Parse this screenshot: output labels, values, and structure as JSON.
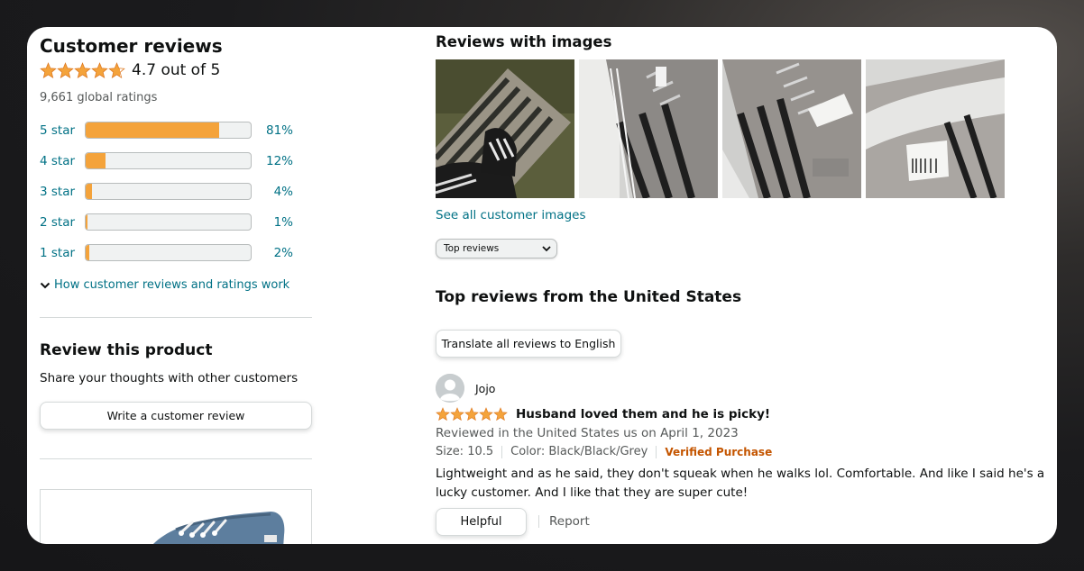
{
  "ratings": {
    "title": "Customer reviews",
    "stars": 4.7,
    "average_text": "4.7 out of 5",
    "global_ratings": "9,661 global ratings",
    "histogram": [
      {
        "label": "5 star",
        "percent_text": "81%",
        "fraction": 0.81
      },
      {
        "label": "4 star",
        "percent_text": "12%",
        "fraction": 0.12
      },
      {
        "label": "3 star",
        "percent_text": "4%",
        "fraction": 0.04
      },
      {
        "label": "2 star",
        "percent_text": "1%",
        "fraction": 0.01
      },
      {
        "label": "1 star",
        "percent_text": "2%",
        "fraction": 0.02
      }
    ],
    "how_link": "How customer reviews and ratings work"
  },
  "review_product": {
    "title": "Review this product",
    "subtitle": "Share your thoughts with other customers",
    "button_label": "Write a customer review"
  },
  "images_section": {
    "title": "Reviews with images",
    "see_all": "See all customer images",
    "thumbnail_count": 4
  },
  "sort": {
    "selected": "Top reviews"
  },
  "top_reviews": {
    "title": "Top reviews from the United States",
    "translate_button": "Translate all reviews to English"
  },
  "review": {
    "reviewer": "Jojo",
    "stars": 5,
    "headline": "Husband loved them and he is picky!",
    "date_line": "Reviewed in the United States us on April 1, 2023",
    "size": "Size: 10.5",
    "color": "Color: Black/Black/Grey",
    "verified": "Verified Purchase",
    "body": "Lightweight and as he said, they don't squeak when he walks lol. Comfortable. And like I said he's a lucky customer. And I like that they are super cute!",
    "helpful_label": "Helpful",
    "report_label": "Report"
  },
  "colors": {
    "star": "#f4a33b",
    "link": "#007185",
    "verified": "#c45500",
    "muted_text": "#565959"
  }
}
